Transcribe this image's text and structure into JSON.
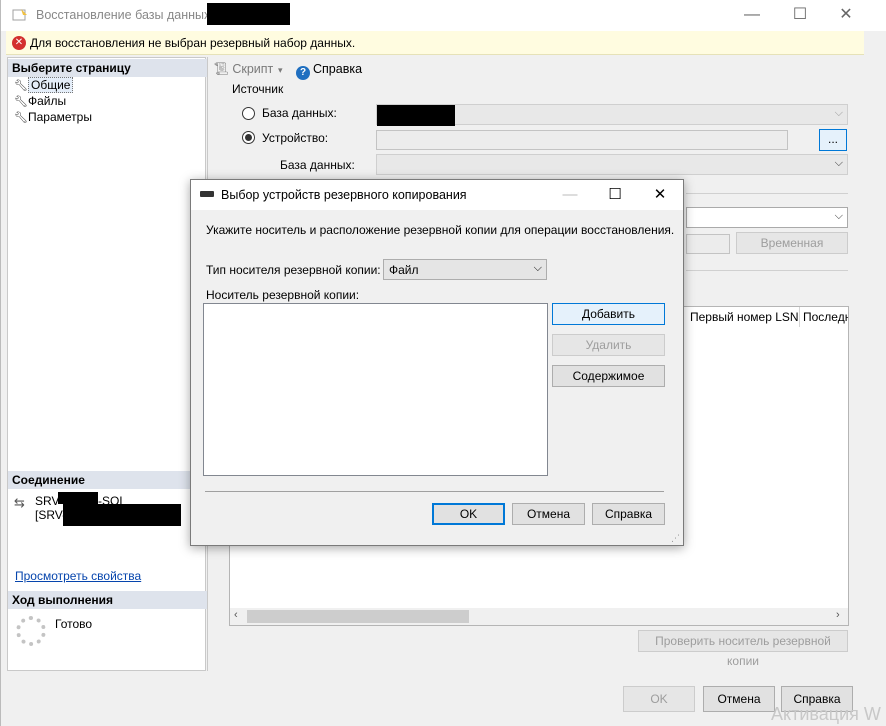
{
  "window": {
    "title": "Восстановление базы данных -",
    "controls": {
      "minimize": "—",
      "maximize": "☐",
      "close": "✕"
    }
  },
  "error_bar": {
    "icon": "error-icon",
    "text": "Для восстановления не выбран резервный набор данных."
  },
  "left_pane": {
    "pages_header": "Выберите страницу",
    "pages": [
      {
        "label": "Общие",
        "icon": "wrench-icon",
        "selected": true
      },
      {
        "label": "Файлы",
        "icon": "wrench-icon",
        "selected": false
      },
      {
        "label": "Параметры",
        "icon": "wrench-icon",
        "selected": false
      }
    ],
    "connection_header": "Соединение",
    "connection_server": "SRV-",
    "connection_server_suffix": "-SQL",
    "connection_user": "[SRV-",
    "view_properties_link": "Просмотреть свойства",
    "progress_header": "Ход выполнения",
    "progress_status": "Готово"
  },
  "toolbar": {
    "script_label": "Скрипт",
    "help_label": "Справка"
  },
  "source": {
    "group_label": "Источник",
    "database_option": "База данных:",
    "device_option": "Устройство:",
    "device_value": "",
    "browse_button": "...",
    "database_label": "База данных:",
    "selected_option": "device"
  },
  "destination": {
    "timeline_button": "Временная"
  },
  "backup_sets_grid": {
    "columns": [
      "Первый номер LSN",
      "Последн"
    ]
  },
  "verify_button": "Проверить носитель резервной копии",
  "footer": {
    "ok": "OK",
    "cancel": "Отмена",
    "help": "Справка"
  },
  "dialog": {
    "title": "Выбор устройств резервного копирования",
    "controls": {
      "minimize": "—",
      "maximize": "☐",
      "close": "✕"
    },
    "instruction": "Укажите носитель и расположение резервной копии для операции восстановления.",
    "media_type_label": "Тип носителя резервной копии:",
    "media_type_value": "Файл",
    "media_list_label": "Носитель резервной копии:",
    "media_items": [],
    "add_button": "Добавить",
    "remove_button": "Удалить",
    "contents_button": "Содержимое",
    "ok": "OK",
    "cancel": "Отмена",
    "help": "Справка"
  },
  "watermark": "Активация W"
}
